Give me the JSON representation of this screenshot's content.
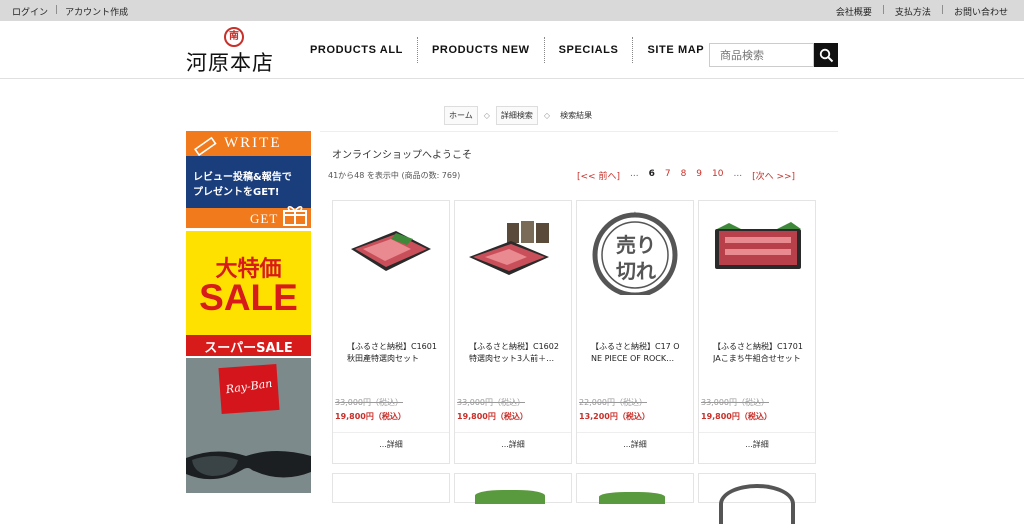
{
  "topbar": {
    "login": "ログイン",
    "signup": "アカウント作成",
    "company": "会社概要",
    "payment": "支払方法",
    "contact": "お問い合わせ"
  },
  "logo": {
    "mark": "南",
    "text": "河原本店"
  },
  "nav": [
    "PRODUCTS ALL",
    "PRODUCTS NEW",
    "SPECIALS",
    "SITE MAP"
  ],
  "search": {
    "placeholder": "商品検索"
  },
  "breadcrumb": [
    "ホーム",
    "詳細検索",
    "検索結果"
  ],
  "banners": {
    "write": {
      "title": "WRITE",
      "line1": "レビュー投稿&報告で",
      "line2": "プレゼントをGET!",
      "footer": "GET"
    },
    "sale": {
      "line1": "大特価",
      "line2": "SALE",
      "line3": "スーパーSALE"
    },
    "rayban": {
      "brand": "Ray-Ban"
    }
  },
  "main": {
    "welcome": "オンラインショップへようこそ",
    "count": "41から48 を表示中 (商品の数: 769)",
    "pager": {
      "prev": "[<< 前へ]",
      "dots": "...",
      "current": "6",
      "pages": [
        "7",
        "8",
        "9",
        "10"
      ],
      "next": "[次へ >>]"
    }
  },
  "products": [
    {
      "name1": "【ふるさと納税】C1601",
      "name2": "秋田產特選肉セット",
      "old": "33,000円（税込）",
      "new": "19,800円（税込）",
      "detail": "...詳細",
      "image": "beef-tray"
    },
    {
      "name1": "【ふるさと納税】C1602",
      "name2": "特選肉セット3人前＋…",
      "old": "33,000円（税込）",
      "new": "19,800円（税込）",
      "detail": "...詳細",
      "image": "beef-set"
    },
    {
      "name1": "【ふるさと納税】C17 O",
      "name2": "NE PIECE OF ROCK…",
      "old": "22,000円（税込）",
      "new": "13,200円（税込）",
      "detail": "...詳細",
      "image": "sold-out",
      "stamp1": "売り",
      "stamp2": "切れ"
    },
    {
      "name1": "【ふるさと納税】C1701",
      "name2": "JAこまち牛組合せセット",
      "old": "33,000円（税込）",
      "new": "19,800円（税込）",
      "detail": "...詳細",
      "image": "beef-slices"
    }
  ],
  "colors": {
    "accent": "#c8302a",
    "topbar": "#d9d9d9",
    "write_orange": "#f07a1c",
    "write_navy": "#1a3d7c",
    "sale_yellow": "#ffe100"
  }
}
